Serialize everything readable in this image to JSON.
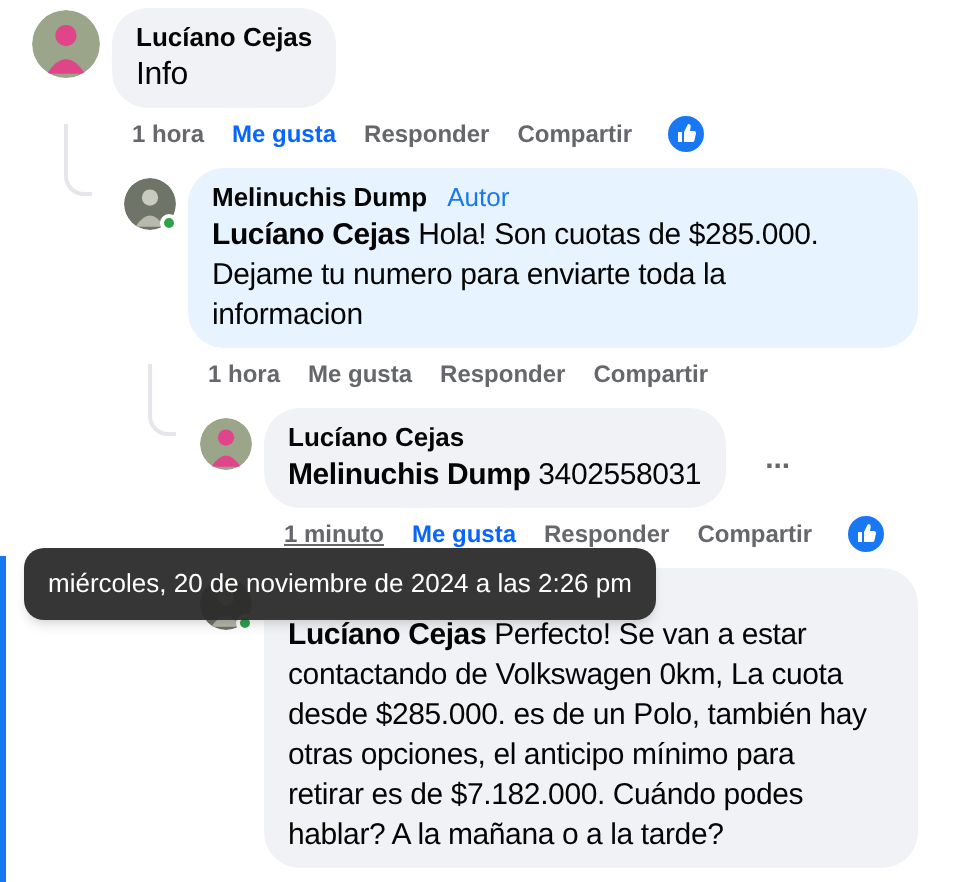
{
  "comments": [
    {
      "author": "Lucíano Cejas",
      "online": false,
      "text": "Info",
      "time": "1 hora",
      "time_hovered": false,
      "liked": true,
      "like_label": "Me gusta",
      "reply_label": "Responder",
      "share_label": "Compartir",
      "reaction": true,
      "children": [
        {
          "author": "Melinuchis Dump",
          "badge": "Autor",
          "online": true,
          "mention": "Lucíano Cejas",
          "text": "Hola! Son cuotas de $285.000. Dejame tu numero para enviarte toda la informacion",
          "time": "1 hora",
          "time_hovered": false,
          "liked": false,
          "like_label": "Me gusta",
          "reply_label": "Responder",
          "share_label": "Compartir",
          "reaction": false,
          "children": [
            {
              "author": "Lucíano Cejas",
              "online": false,
              "mention": "Melinuchis Dump",
              "text": "3402558031",
              "menu": "...",
              "time": "1 minuto",
              "time_hovered": true,
              "liked": true,
              "like_label": "Me gusta",
              "reply_label": "Responder",
              "share_label": "Compartir",
              "reaction": true
            },
            {
              "online": true,
              "mention": "Lucíano Cejas",
              "text": "Perfecto! Se van a estar contactando de Volkswagen 0km, La cuota desde $285.000. es de un Polo, también hay otras opciones, el anticipo mínimo para retirar es de $7.182.000. Cuándo podes hablar? A la mañana o a la tarde?"
            }
          ]
        }
      ]
    }
  ],
  "tooltip": "miércoles, 20 de noviembre de 2024 a las 2:26 pm"
}
